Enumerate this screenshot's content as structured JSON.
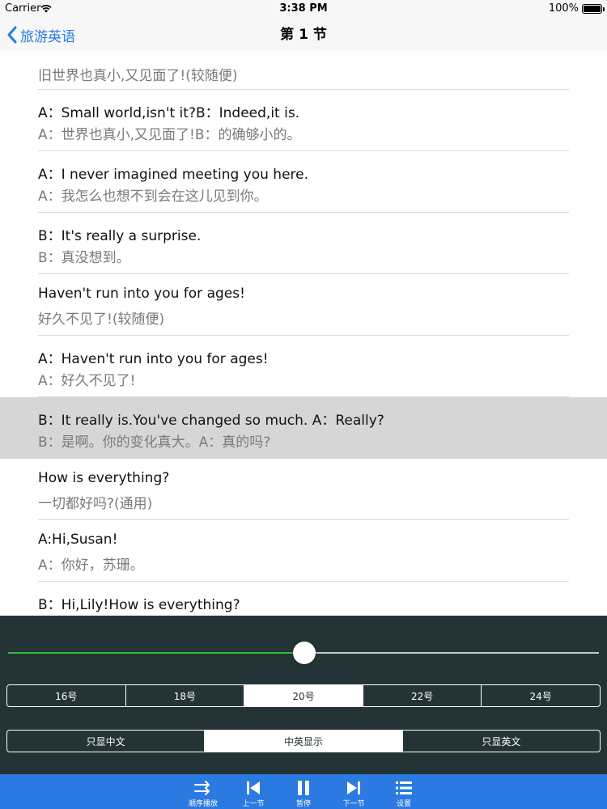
{
  "status_bar": {
    "carrier": "Carrier",
    "time": "3:38 PM",
    "battery": "100%"
  },
  "nav": {
    "back_label": "旅游英语",
    "title": "第 1 节"
  },
  "items": [
    {
      "en": "",
      "zh": "旧世界也真小,又见面了!(较随便)"
    },
    {
      "en": "A：Small world,isn't it?B：Indeed,it is.",
      "zh": "A：世界也真小,又见面了!B：的确够小的。"
    },
    {
      "en": "A：I never imagined meeting you here.",
      "zh": "A：我怎么也想不到会在这儿见到你。"
    },
    {
      "en": "B：It's really a surprise.",
      "zh": "B：真没想到。"
    },
    {
      "en": "Haven't run into you for ages!",
      "zh": "好久不见了!(较随便)"
    },
    {
      "en": "A：Haven't run into you for ages!",
      "zh": "A：好久不见了!"
    },
    {
      "en": "B：It really is.You've changed so much.  A：Really?",
      "zh": "B：是啊。你的变化真大。A：真的吗?"
    },
    {
      "en": "How is everything?",
      "zh": "一切都好吗?(通用)"
    },
    {
      "en": "A:Hi,Susan!",
      "zh": "A：你好，苏珊。"
    },
    {
      "en": "B：Hi,Lily!How is everything?",
      "zh": "B：你好，莉莉。一切都好吗?"
    }
  ],
  "selected_index": 6,
  "player": {
    "progress": 0.501
  },
  "font_sizes": {
    "options": [
      "16号",
      "18号",
      "20号",
      "22号",
      "24号"
    ],
    "selected": 2
  },
  "display_modes": {
    "options": [
      "只显中文",
      "中英显示",
      "只显英文"
    ],
    "selected": 1
  },
  "tabs": [
    {
      "label": "顺序播放",
      "icon": "repeat-icon"
    },
    {
      "label": "上一节",
      "icon": "previous-icon"
    },
    {
      "label": "暂停",
      "icon": "pause-icon"
    },
    {
      "label": "下一节",
      "icon": "next-icon"
    },
    {
      "label": "设置",
      "icon": "list-settings-icon"
    }
  ],
  "colors": {
    "accent": "#2a7ae2",
    "panel": "#243336",
    "progress": "#2fbf3b",
    "selected_row": "#d6d6d6"
  }
}
